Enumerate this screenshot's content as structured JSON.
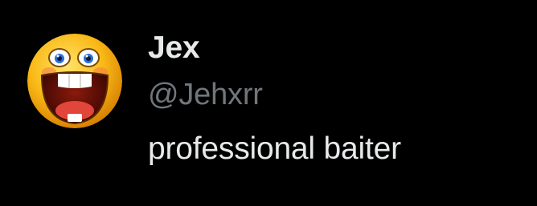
{
  "post": {
    "author": {
      "display_name": "Jex",
      "handle": "@Jehxrr",
      "avatar_icon": "laughing-emoji-icon"
    },
    "text": "professional baiter"
  },
  "colors": {
    "background": "#000000",
    "primary_text": "#e7e9ea",
    "secondary_text": "#71767b"
  }
}
